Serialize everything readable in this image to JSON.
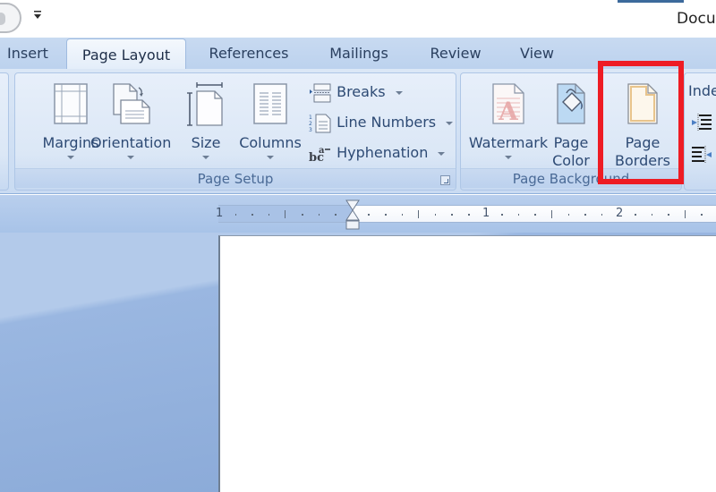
{
  "titlebar": {
    "title": "Docu",
    "quick_access_dropdown_icon": "customize-qat-icon"
  },
  "tabs": [
    {
      "label": "Insert",
      "active": false
    },
    {
      "label": "Page Layout",
      "active": true
    },
    {
      "label": "References",
      "active": false
    },
    {
      "label": "Mailings",
      "active": false
    },
    {
      "label": "Review",
      "active": false
    },
    {
      "label": "View",
      "active": false
    }
  ],
  "ribbon": {
    "page_setup": {
      "label": "Page Setup",
      "margins": {
        "label": "Margins",
        "icon": "margins-icon"
      },
      "orientation": {
        "label": "Orientation",
        "icon": "orientation-icon"
      },
      "size": {
        "label": "Size",
        "icon": "size-icon"
      },
      "columns": {
        "label": "Columns",
        "icon": "columns-icon"
      },
      "breaks": {
        "label": "Breaks",
        "icon": "breaks-icon"
      },
      "line_numbers": {
        "label": "Line Numbers",
        "icon": "line-numbers-icon"
      },
      "hyphenation": {
        "label": "Hyphenation",
        "icon": "hyphenation-icon"
      }
    },
    "page_background": {
      "label": "Page Background",
      "watermark": {
        "label": "Watermark",
        "icon": "watermark-icon"
      },
      "page_color": {
        "line1": "Page",
        "line2": "Color",
        "icon": "page-color-icon"
      },
      "page_borders": {
        "line1": "Page",
        "line2": "Borders",
        "icon": "page-borders-icon"
      }
    },
    "paragraph": {
      "indent_label": "Inde"
    },
    "highlight_color": "#ee1c24"
  },
  "ruler": {
    "numbers": [
      "1",
      "1",
      "2"
    ]
  }
}
